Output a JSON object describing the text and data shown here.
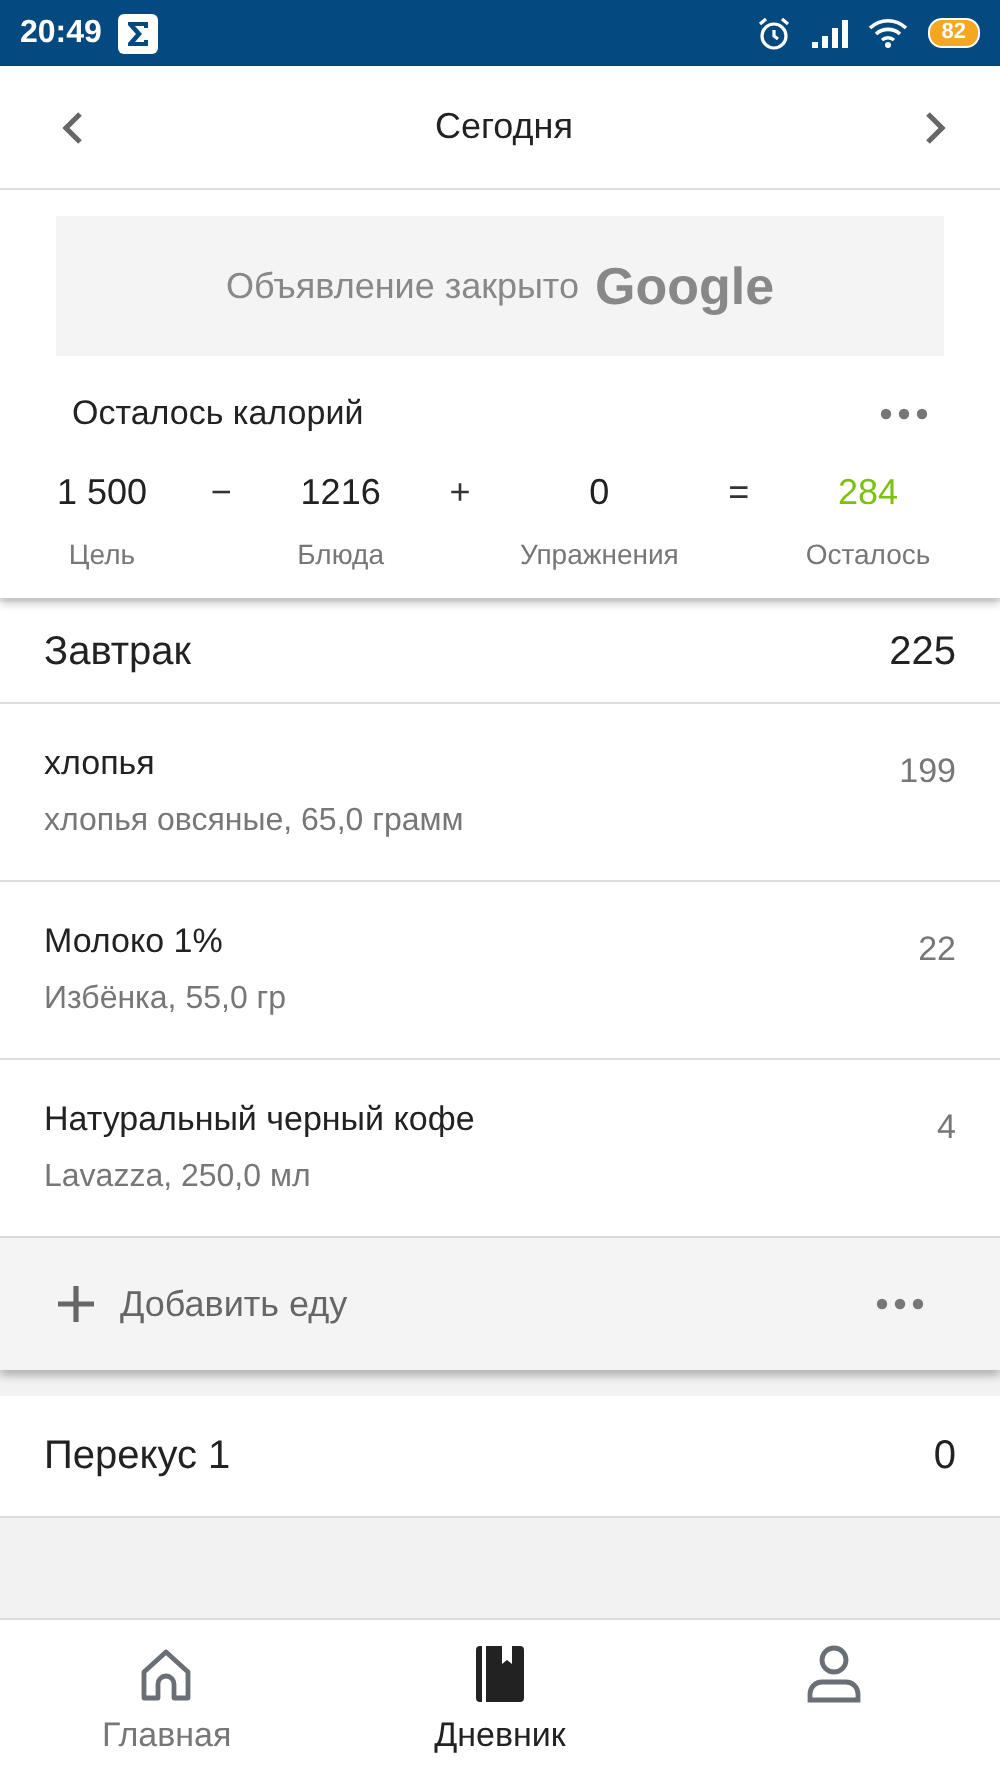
{
  "status_bar": {
    "time": "20:49",
    "battery": "82"
  },
  "date_nav": {
    "title": "Сегодня"
  },
  "ad": {
    "text": "Объявление закрыто",
    "brand": "Google"
  },
  "calories": {
    "title": "Осталось калорий",
    "items": [
      {
        "value": "1 500",
        "label": "Цель",
        "kind": "term"
      },
      {
        "operator": "−"
      },
      {
        "value": "1216",
        "label": "Блюда",
        "kind": "term"
      },
      {
        "operator": "+"
      },
      {
        "value": "0",
        "label": "Упражнения",
        "kind": "term"
      },
      {
        "operator": "="
      },
      {
        "value": "284",
        "label": "Осталось",
        "kind": "result"
      }
    ]
  },
  "meals": [
    {
      "name": "Завтрак",
      "total": "225",
      "foods": [
        {
          "name": "хлопья",
          "detail": "хлопья овсяные, 65,0 грамм",
          "calories": "199"
        },
        {
          "name": "Молоко 1%",
          "detail": "Избёнка, 55,0 гр",
          "calories": "22"
        },
        {
          "name": "Натуральный черный кофе",
          "detail": "Lavazza, 250,0 мл",
          "calories": "4"
        }
      ],
      "add_label": "Добавить еду"
    },
    {
      "name": "Перекус 1",
      "total": "0"
    }
  ],
  "bottom_nav": [
    {
      "label": "Главная",
      "kind": "home",
      "selected": false
    },
    {
      "label": "Дневник",
      "kind": "diary",
      "selected": true
    },
    {
      "kind": "profile",
      "selected": false
    }
  ]
}
